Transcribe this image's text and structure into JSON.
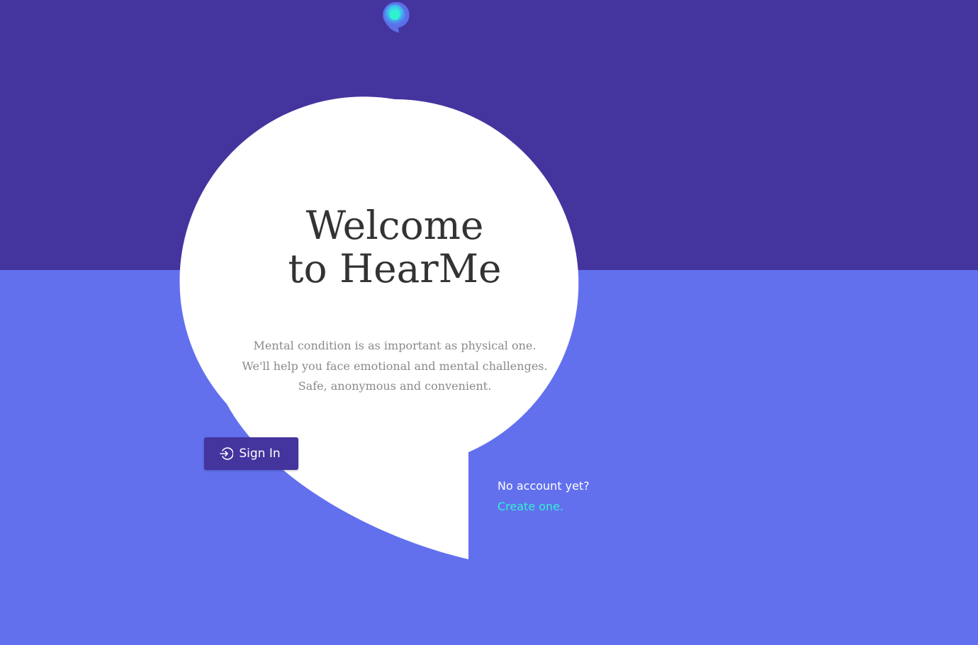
{
  "colors": {
    "top_background": "#44349e",
    "bottom_background": "#6270ee",
    "bubble": "#ffffff",
    "accent_link": "#34f0d0"
  },
  "logo": {
    "icon": "speech-bubble-logo-icon"
  },
  "hero": {
    "title_line1": "Welcome",
    "title_line2": "to HearMe",
    "subtitle_line1": "Mental condition is as important as physical one.",
    "subtitle_line2": "We'll help you face emotional and mental challenges.",
    "subtitle_line3": "Safe, anonymous and convenient."
  },
  "signin": {
    "label": "Sign In",
    "icon": "sign-in-icon"
  },
  "signup": {
    "prompt": "No account yet?",
    "link": "Create one."
  }
}
